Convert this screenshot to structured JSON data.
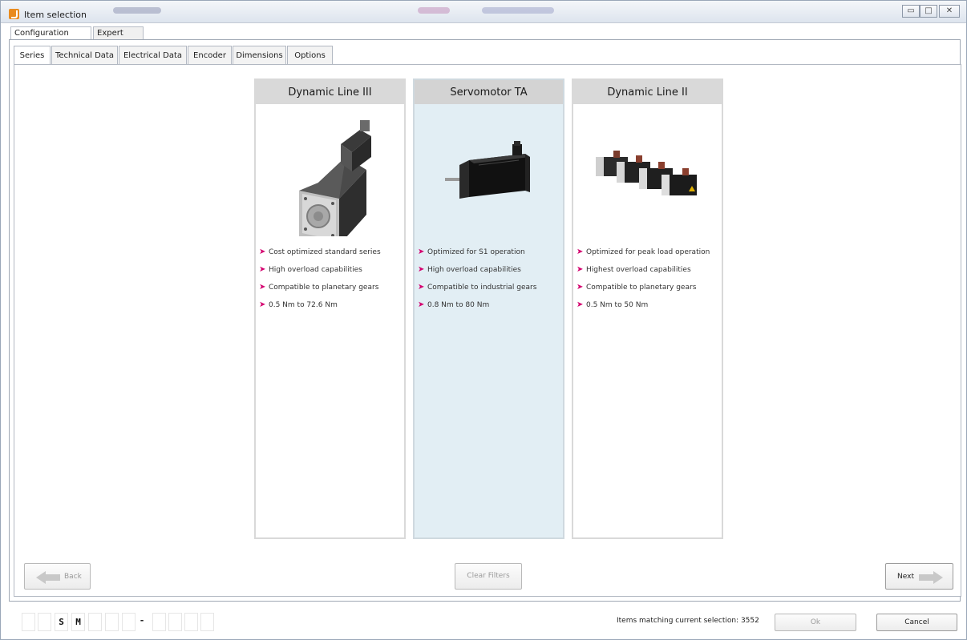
{
  "window": {
    "title": "Item selection",
    "controls": [
      "minimize",
      "maximize",
      "close"
    ]
  },
  "view_tabs": [
    {
      "label": "Configuration wizard",
      "active": true
    },
    {
      "label": "Expert view",
      "active": false
    }
  ],
  "wizard_tabs": [
    {
      "label": "Series",
      "active": true
    },
    {
      "label": "Technical Data",
      "active": false
    },
    {
      "label": "Electrical Data",
      "active": false
    },
    {
      "label": "Encoder",
      "active": false
    },
    {
      "label": "Dimensions",
      "active": false
    },
    {
      "label": "Options",
      "active": false
    }
  ],
  "series": [
    {
      "title": "Dynamic Line III",
      "selected": false,
      "image": "single-servo-motor-photo",
      "features": [
        "Cost optimized standard series",
        "High overload capabilities",
        "Compatible to planetary gears",
        "0.5 Nm to 72.6 Nm"
      ]
    },
    {
      "title": "Servomotor TA",
      "selected": true,
      "image": "black-servomotor-photo",
      "features": [
        "Optimized for S1 operation",
        "High overload capabilities",
        "Compatible to industrial gears",
        "0.8 Nm to 80 Nm"
      ]
    },
    {
      "title": "Dynamic Line II",
      "selected": false,
      "image": "motor-group-photo",
      "features": [
        "Optimized for peak load operation",
        "Highest overload capabilities",
        "Compatible to planetary gears",
        "0.5 Nm to 50 Nm"
      ]
    }
  ],
  "feature_marker": "➤",
  "buttons": {
    "back": "Back",
    "clear_filters": "Clear Filters",
    "next": "Next",
    "ok": "Ok",
    "cancel": "Cancel"
  },
  "type_code": {
    "chars": [
      "",
      "",
      "S",
      "M",
      "",
      "",
      "",
      "-",
      "",
      "",
      "",
      ""
    ]
  },
  "status": {
    "matching_text": "Items matching current selection: 3552"
  },
  "colors": {
    "accent_arrow": "#d4006f",
    "selected_card": "#e2eef4",
    "card_header": "#d9d9d9",
    "nav_arrow": "#c8c8c8"
  }
}
